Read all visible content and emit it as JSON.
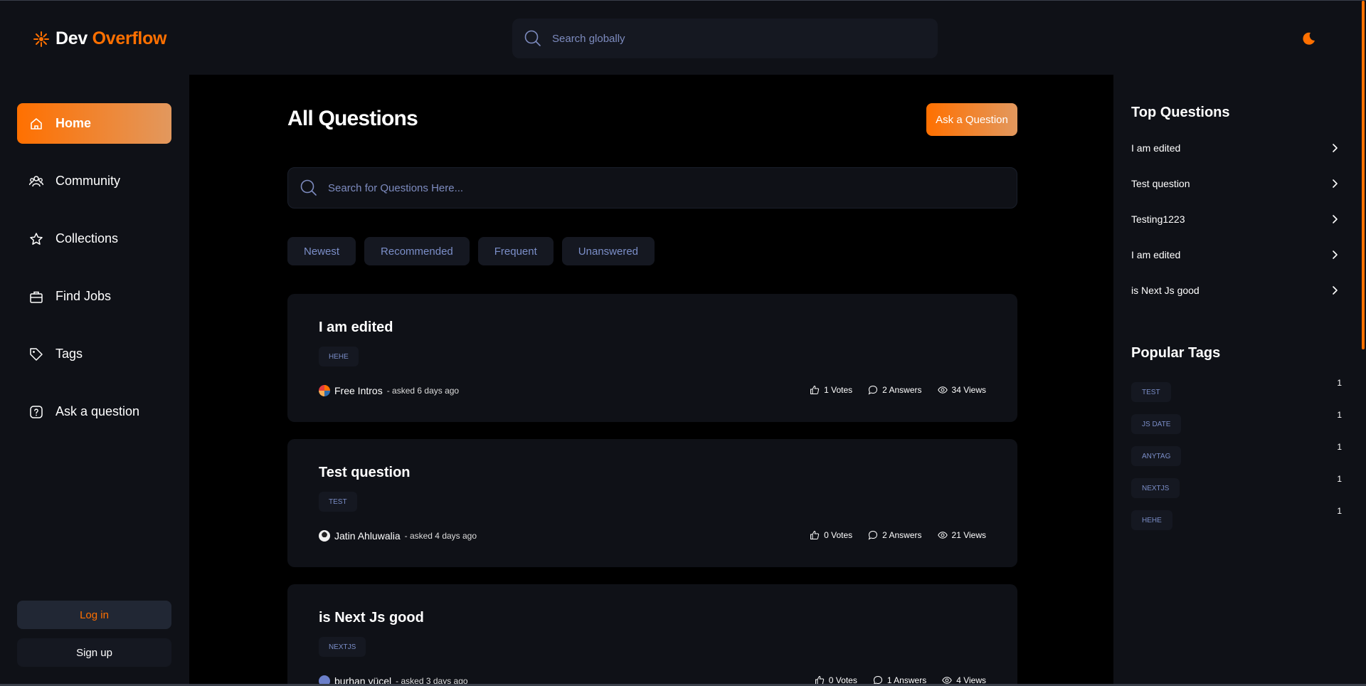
{
  "header": {
    "logo_prefix": "Dev",
    "logo_accent": "Overflow",
    "search_placeholder": "Search globally"
  },
  "sidebar": {
    "items": [
      {
        "label": "Home",
        "icon": "home-icon",
        "active": true
      },
      {
        "label": "Community",
        "icon": "users-icon"
      },
      {
        "label": "Collections",
        "icon": "star-icon"
      },
      {
        "label": "Find Jobs",
        "icon": "briefcase-icon"
      },
      {
        "label": "Tags",
        "icon": "tag-icon"
      },
      {
        "label": "Ask a question",
        "icon": "question-icon"
      }
    ],
    "login_label": "Log in",
    "signup_label": "Sign up"
  },
  "main": {
    "title": "All Questions",
    "ask_button": "Ask a Question",
    "search_placeholder": "Search for Questions Here...",
    "filters": [
      "Newest",
      "Recommended",
      "Frequent",
      "Unanswered"
    ],
    "questions": [
      {
        "title": "I am edited",
        "tag": "HEHE",
        "author": "Free Intros",
        "asked": "- asked 6 days ago",
        "votes": "1 Votes",
        "answers": "2 Answers",
        "views": "34 Views"
      },
      {
        "title": "Test question",
        "tag": "TEST",
        "author": "Jatin Ahluwalia",
        "asked": "- asked 4 days ago",
        "votes": "0 Votes",
        "answers": "2 Answers",
        "views": "21 Views"
      },
      {
        "title": "is Next Js good",
        "tag": "NEXTJS",
        "author": "burhan yücel",
        "asked": "- asked 3 days ago",
        "votes": "0 Votes",
        "answers": "1 Answers",
        "views": "4 Views"
      }
    ]
  },
  "right": {
    "top_title": "Top Questions",
    "top_questions": [
      "I am edited",
      "Test question",
      "Testing1223",
      "I am edited",
      "is Next Js good"
    ],
    "tags_title": "Popular Tags",
    "tags": [
      {
        "name": "TEST",
        "count": "1"
      },
      {
        "name": "JS DATE",
        "count": "1"
      },
      {
        "name": "ANYTAG",
        "count": "1"
      },
      {
        "name": "NEXTJS",
        "count": "1"
      },
      {
        "name": "HEHE",
        "count": "1"
      }
    ]
  },
  "colors": {
    "accent": "#ff7000",
    "background": "#0f1117",
    "main_background": "#000000",
    "muted_text": "#7b8ec8"
  }
}
